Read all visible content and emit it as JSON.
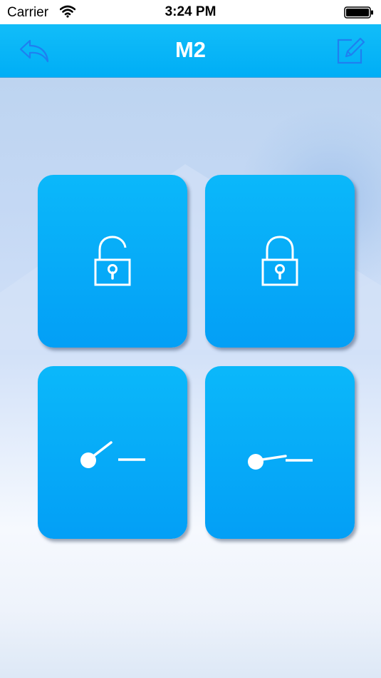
{
  "status_bar": {
    "carrier": "Carrier",
    "time": "3:24 PM",
    "icons": [
      "wifi-icon",
      "battery-icon"
    ]
  },
  "nav": {
    "title": "M2",
    "left_icon": "back-arrow-icon",
    "right_icon": "edit-icon"
  },
  "tiles": [
    {
      "icon": "unlock-icon"
    },
    {
      "icon": "lock-icon"
    },
    {
      "icon": "switch-open-icon"
    },
    {
      "icon": "switch-closed-icon"
    }
  ],
  "colors": {
    "nav_background": "#00aef6",
    "tile_background": "#0bb8fa",
    "nav_icon": "#1f7ff0",
    "tile_icon": "#ffffff"
  }
}
